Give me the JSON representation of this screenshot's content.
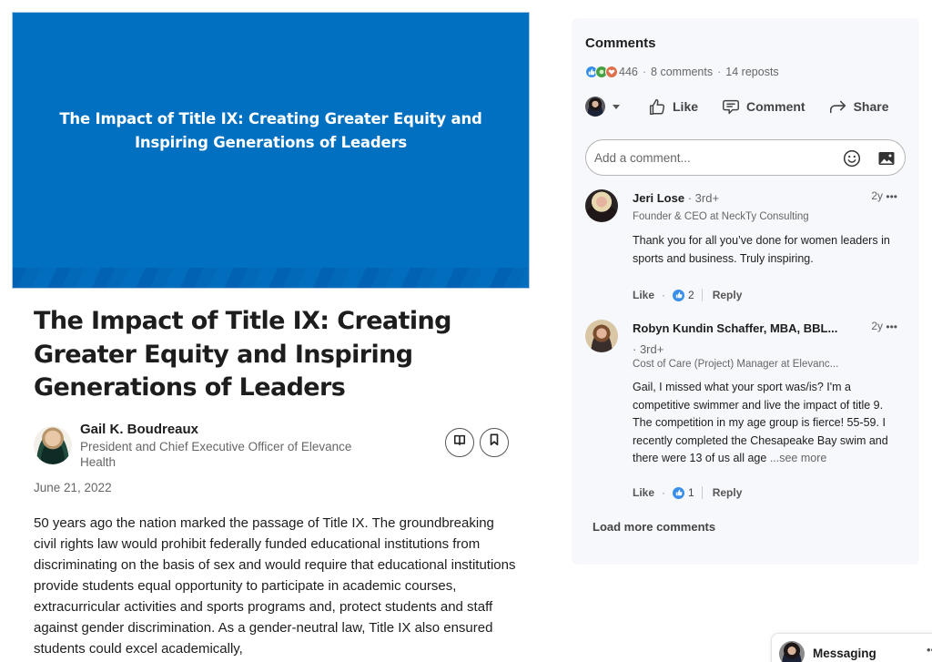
{
  "article": {
    "cover_title": "The Impact of Title IX: Creating Greater Equity and Inspiring Generations of Leaders",
    "cover_color": "#0170c1",
    "headline": "The Impact of Title IX: Creating Greater Equity and Inspiring Generations of Leaders",
    "author": {
      "name": "Gail K. Boudreaux",
      "headline": "President and Chief Executive Officer of Elevance Health"
    },
    "buttons": {
      "read_icon": "book-open-icon",
      "save_icon": "bookmark-icon"
    },
    "date": "June 21, 2022",
    "body": "50 years ago the nation marked the passage of Title IX. The groundbreaking civil rights law would prohibit federally funded educational institutions from discriminating on the basis of sex and would require that educational institutions provide students equal opportunity to participate in academic courses, extracurricular activities and sports programs and, protect students and staff against gender discrimination. As a gender-neutral law, Title IX also ensured students could excel academically,"
  },
  "comments_panel": {
    "title": "Comments",
    "reactions_count": "446",
    "comments_count": "8 comments",
    "reposts_count": "14 reposts",
    "separator": "·",
    "reaction_icons": [
      "like-icon",
      "celebrate-icon",
      "love-icon"
    ],
    "actions": {
      "like": "Like",
      "comment": "Comment",
      "share": "Share"
    },
    "comment_box": {
      "placeholder": "Add a comment...",
      "value": ""
    },
    "comments": [
      {
        "name": "Jeri Lose",
        "degree": "· 3rd+",
        "headline": "Founder & CEO at NeckTy Consulting",
        "time": "2y",
        "more": "•••",
        "text": "Thank you for all you’ve done for women leaders in sports and business. Truly inspiring.",
        "see_more": "",
        "like_label": "Like",
        "like_count": "2",
        "reply_label": "Reply"
      },
      {
        "name": "Robyn Kundin Schaffer, MBA, BBL...",
        "degree": "· 3rd+",
        "headline": "Cost of Care (Project) Manager at Elevanc...",
        "time": "2y",
        "more": "•••",
        "text": "Gail, I missed what your sport was/is? I'm a competitive swimmer and live the impact of title 9. The competition in my age group is fierce! 55-59. I recently completed the Chesapeake Bay swim and there were 13 of us all age",
        "see_more": "...see more",
        "like_label": "Like",
        "like_count": "1",
        "reply_label": "Reply"
      }
    ],
    "load_more": "Load more comments"
  },
  "messaging": {
    "label": "Messaging",
    "more": "••"
  }
}
